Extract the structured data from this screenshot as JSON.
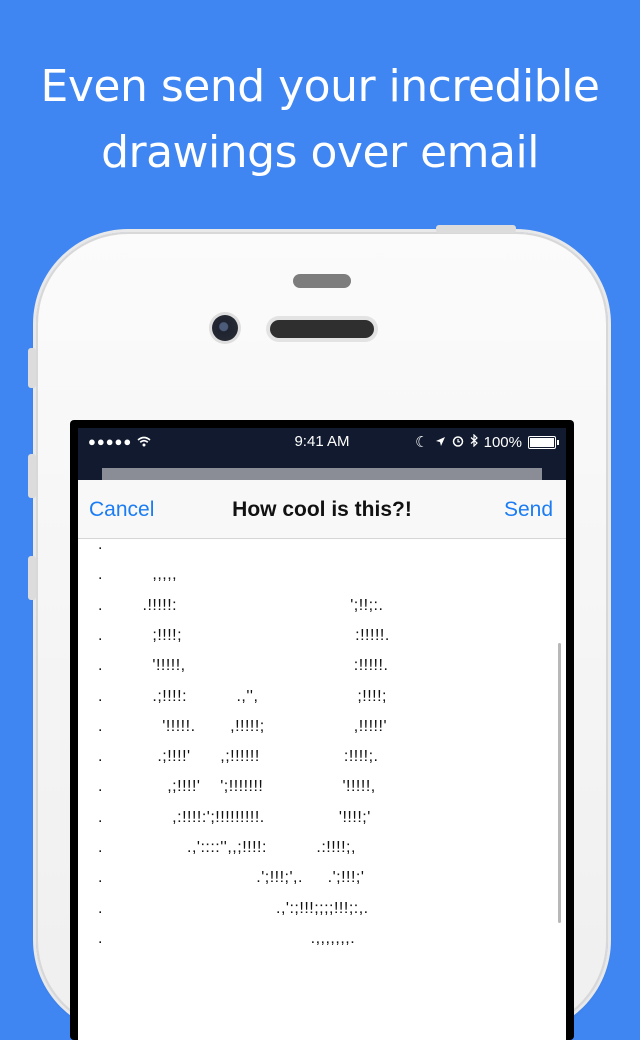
{
  "headline": {
    "line1": "Even send your incredible",
    "line2": "drawings over email"
  },
  "status_bar": {
    "signal": "●●●●●",
    "wifi_icon": "wifi-icon",
    "time": "9:41 AM",
    "icons": [
      "moon-icon",
      "location-arrow-icon",
      "alarm-icon",
      "bluetooth-icon"
    ],
    "battery_percent": "100%"
  },
  "compose": {
    "cancel_label": "Cancel",
    "title": "How cool is this?!",
    "send_label": "Send",
    "ascii_art": [
      ".",
      ".          ,,,,,",
      ".        .!!!!!:                                   ';!!;:.",
      ".          ;!!!!;                                   :!!!!!.",
      ".          '!!!!!,                                  :!!!!!.",
      ".          .;!!!!:          .,'',                    ;!!!!;",
      ".            '!!!!!.       ,!!!!!;                  ,!!!!!'",
      ".           .;!!!!'      ,;!!!!!!                 :!!!!;.",
      ".             ,;!!!!'    ';!!!!!!!                '!!!!!,",
      ".              ,:!!!!:';!!!!!!!!!.               '!!!!;'",
      ".                 .,'::::'',,;!!!!:          .:!!!!;,",
      ".                               .';!!!;',.     .';!!!;'",
      ".                                   .,':;!!!;;;;!!!;:,.",
      ".                                          .,,,,,,,."
    ]
  },
  "colors": {
    "background": "#3f86f2",
    "accent": "#1b7cf3"
  }
}
